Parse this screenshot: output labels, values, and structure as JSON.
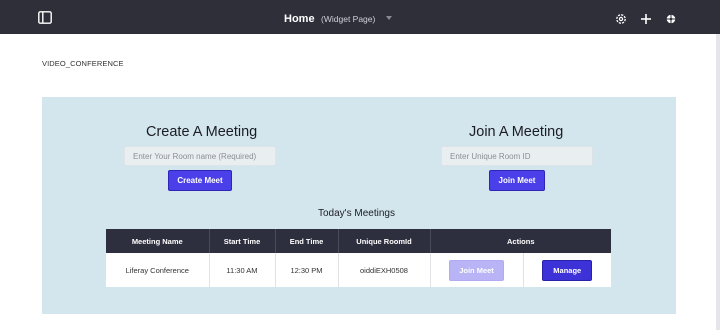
{
  "topbar": {
    "title": "Home",
    "subtitle": "(Widget Page)",
    "icons": [
      "sidebar-toggle-icon",
      "settings-icon",
      "plus-icon",
      "simulation-icon"
    ]
  },
  "portlet": {
    "label": "VIDEO_CONFERENCE"
  },
  "create": {
    "heading": "Create A Meeting",
    "placeholder": "Enter Your Room name (Required)",
    "button": "Create Meet"
  },
  "join": {
    "heading": "Join A Meeting",
    "placeholder": "Enter Unique Room ID",
    "button": "Join Meet"
  },
  "meetings": {
    "heading": "Today's Meetings",
    "columns": [
      "Meeting Name",
      "Start Time",
      "End Time",
      "Unique RoomId",
      "Actions"
    ],
    "rows": [
      {
        "name": "Liferay Conference",
        "start": "11:30 AM",
        "end": "12:30 PM",
        "room_id": "oiddiEXH0508",
        "join_label": "Join Meet",
        "manage_label": "Manage"
      }
    ]
  },
  "colors": {
    "topbar": "#2f2f3a",
    "panel": "#d3e6ee",
    "accent": "#4a3fe8",
    "table_header": "#2e2f3e"
  }
}
